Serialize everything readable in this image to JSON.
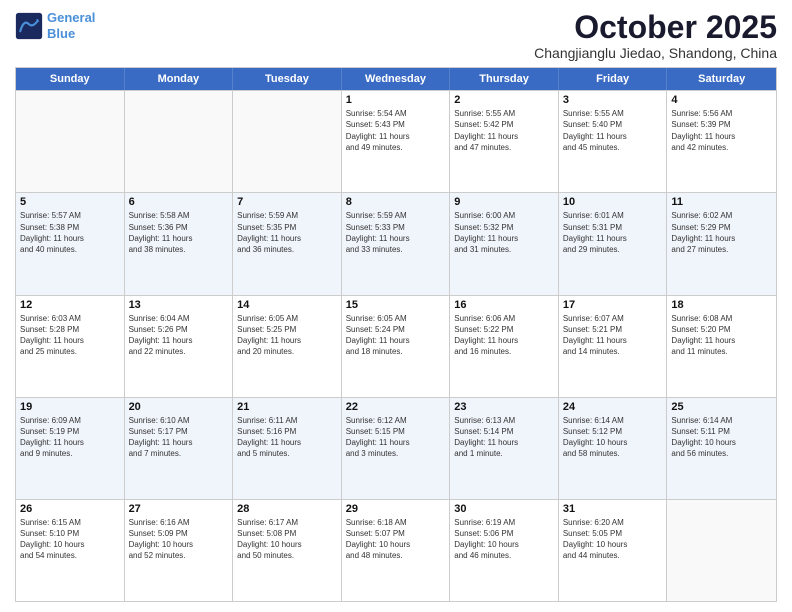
{
  "header": {
    "logo_line1": "General",
    "logo_line2": "Blue",
    "month": "October 2025",
    "location": "Changjianglu Jiedao, Shandong, China"
  },
  "weekdays": [
    "Sunday",
    "Monday",
    "Tuesday",
    "Wednesday",
    "Thursday",
    "Friday",
    "Saturday"
  ],
  "rows": [
    [
      {
        "date": "",
        "info": ""
      },
      {
        "date": "",
        "info": ""
      },
      {
        "date": "",
        "info": ""
      },
      {
        "date": "1",
        "info": "Sunrise: 5:54 AM\nSunset: 5:43 PM\nDaylight: 11 hours\nand 49 minutes."
      },
      {
        "date": "2",
        "info": "Sunrise: 5:55 AM\nSunset: 5:42 PM\nDaylight: 11 hours\nand 47 minutes."
      },
      {
        "date": "3",
        "info": "Sunrise: 5:55 AM\nSunset: 5:40 PM\nDaylight: 11 hours\nand 45 minutes."
      },
      {
        "date": "4",
        "info": "Sunrise: 5:56 AM\nSunset: 5:39 PM\nDaylight: 11 hours\nand 42 minutes."
      }
    ],
    [
      {
        "date": "5",
        "info": "Sunrise: 5:57 AM\nSunset: 5:38 PM\nDaylight: 11 hours\nand 40 minutes."
      },
      {
        "date": "6",
        "info": "Sunrise: 5:58 AM\nSunset: 5:36 PM\nDaylight: 11 hours\nand 38 minutes."
      },
      {
        "date": "7",
        "info": "Sunrise: 5:59 AM\nSunset: 5:35 PM\nDaylight: 11 hours\nand 36 minutes."
      },
      {
        "date": "8",
        "info": "Sunrise: 5:59 AM\nSunset: 5:33 PM\nDaylight: 11 hours\nand 33 minutes."
      },
      {
        "date": "9",
        "info": "Sunrise: 6:00 AM\nSunset: 5:32 PM\nDaylight: 11 hours\nand 31 minutes."
      },
      {
        "date": "10",
        "info": "Sunrise: 6:01 AM\nSunset: 5:31 PM\nDaylight: 11 hours\nand 29 minutes."
      },
      {
        "date": "11",
        "info": "Sunrise: 6:02 AM\nSunset: 5:29 PM\nDaylight: 11 hours\nand 27 minutes."
      }
    ],
    [
      {
        "date": "12",
        "info": "Sunrise: 6:03 AM\nSunset: 5:28 PM\nDaylight: 11 hours\nand 25 minutes."
      },
      {
        "date": "13",
        "info": "Sunrise: 6:04 AM\nSunset: 5:26 PM\nDaylight: 11 hours\nand 22 minutes."
      },
      {
        "date": "14",
        "info": "Sunrise: 6:05 AM\nSunset: 5:25 PM\nDaylight: 11 hours\nand 20 minutes."
      },
      {
        "date": "15",
        "info": "Sunrise: 6:05 AM\nSunset: 5:24 PM\nDaylight: 11 hours\nand 18 minutes."
      },
      {
        "date": "16",
        "info": "Sunrise: 6:06 AM\nSunset: 5:22 PM\nDaylight: 11 hours\nand 16 minutes."
      },
      {
        "date": "17",
        "info": "Sunrise: 6:07 AM\nSunset: 5:21 PM\nDaylight: 11 hours\nand 14 minutes."
      },
      {
        "date": "18",
        "info": "Sunrise: 6:08 AM\nSunset: 5:20 PM\nDaylight: 11 hours\nand 11 minutes."
      }
    ],
    [
      {
        "date": "19",
        "info": "Sunrise: 6:09 AM\nSunset: 5:19 PM\nDaylight: 11 hours\nand 9 minutes."
      },
      {
        "date": "20",
        "info": "Sunrise: 6:10 AM\nSunset: 5:17 PM\nDaylight: 11 hours\nand 7 minutes."
      },
      {
        "date": "21",
        "info": "Sunrise: 6:11 AM\nSunset: 5:16 PM\nDaylight: 11 hours\nand 5 minutes."
      },
      {
        "date": "22",
        "info": "Sunrise: 6:12 AM\nSunset: 5:15 PM\nDaylight: 11 hours\nand 3 minutes."
      },
      {
        "date": "23",
        "info": "Sunrise: 6:13 AM\nSunset: 5:14 PM\nDaylight: 11 hours\nand 1 minute."
      },
      {
        "date": "24",
        "info": "Sunrise: 6:14 AM\nSunset: 5:12 PM\nDaylight: 10 hours\nand 58 minutes."
      },
      {
        "date": "25",
        "info": "Sunrise: 6:14 AM\nSunset: 5:11 PM\nDaylight: 10 hours\nand 56 minutes."
      }
    ],
    [
      {
        "date": "26",
        "info": "Sunrise: 6:15 AM\nSunset: 5:10 PM\nDaylight: 10 hours\nand 54 minutes."
      },
      {
        "date": "27",
        "info": "Sunrise: 6:16 AM\nSunset: 5:09 PM\nDaylight: 10 hours\nand 52 minutes."
      },
      {
        "date": "28",
        "info": "Sunrise: 6:17 AM\nSunset: 5:08 PM\nDaylight: 10 hours\nand 50 minutes."
      },
      {
        "date": "29",
        "info": "Sunrise: 6:18 AM\nSunset: 5:07 PM\nDaylight: 10 hours\nand 48 minutes."
      },
      {
        "date": "30",
        "info": "Sunrise: 6:19 AM\nSunset: 5:06 PM\nDaylight: 10 hours\nand 46 minutes."
      },
      {
        "date": "31",
        "info": "Sunrise: 6:20 AM\nSunset: 5:05 PM\nDaylight: 10 hours\nand 44 minutes."
      },
      {
        "date": "",
        "info": ""
      }
    ]
  ]
}
